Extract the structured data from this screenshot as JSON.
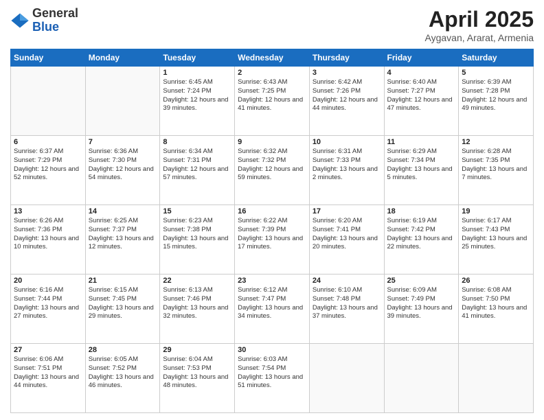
{
  "logo": {
    "general": "General",
    "blue": "Blue"
  },
  "title": "April 2025",
  "location": "Aygavan, Ararat, Armenia",
  "days_of_week": [
    "Sunday",
    "Monday",
    "Tuesday",
    "Wednesday",
    "Thursday",
    "Friday",
    "Saturday"
  ],
  "weeks": [
    [
      {
        "day": "",
        "empty": true
      },
      {
        "day": "",
        "empty": true
      },
      {
        "day": "1",
        "sunrise": "6:45 AM",
        "sunset": "7:24 PM",
        "daylight": "12 hours and 39 minutes."
      },
      {
        "day": "2",
        "sunrise": "6:43 AM",
        "sunset": "7:25 PM",
        "daylight": "12 hours and 41 minutes."
      },
      {
        "day": "3",
        "sunrise": "6:42 AM",
        "sunset": "7:26 PM",
        "daylight": "12 hours and 44 minutes."
      },
      {
        "day": "4",
        "sunrise": "6:40 AM",
        "sunset": "7:27 PM",
        "daylight": "12 hours and 47 minutes."
      },
      {
        "day": "5",
        "sunrise": "6:39 AM",
        "sunset": "7:28 PM",
        "daylight": "12 hours and 49 minutes."
      }
    ],
    [
      {
        "day": "6",
        "sunrise": "6:37 AM",
        "sunset": "7:29 PM",
        "daylight": "12 hours and 52 minutes."
      },
      {
        "day": "7",
        "sunrise": "6:36 AM",
        "sunset": "7:30 PM",
        "daylight": "12 hours and 54 minutes."
      },
      {
        "day": "8",
        "sunrise": "6:34 AM",
        "sunset": "7:31 PM",
        "daylight": "12 hours and 57 minutes."
      },
      {
        "day": "9",
        "sunrise": "6:32 AM",
        "sunset": "7:32 PM",
        "daylight": "12 hours and 59 minutes."
      },
      {
        "day": "10",
        "sunrise": "6:31 AM",
        "sunset": "7:33 PM",
        "daylight": "13 hours and 2 minutes."
      },
      {
        "day": "11",
        "sunrise": "6:29 AM",
        "sunset": "7:34 PM",
        "daylight": "13 hours and 5 minutes."
      },
      {
        "day": "12",
        "sunrise": "6:28 AM",
        "sunset": "7:35 PM",
        "daylight": "13 hours and 7 minutes."
      }
    ],
    [
      {
        "day": "13",
        "sunrise": "6:26 AM",
        "sunset": "7:36 PM",
        "daylight": "13 hours and 10 minutes."
      },
      {
        "day": "14",
        "sunrise": "6:25 AM",
        "sunset": "7:37 PM",
        "daylight": "13 hours and 12 minutes."
      },
      {
        "day": "15",
        "sunrise": "6:23 AM",
        "sunset": "7:38 PM",
        "daylight": "13 hours and 15 minutes."
      },
      {
        "day": "16",
        "sunrise": "6:22 AM",
        "sunset": "7:39 PM",
        "daylight": "13 hours and 17 minutes."
      },
      {
        "day": "17",
        "sunrise": "6:20 AM",
        "sunset": "7:41 PM",
        "daylight": "13 hours and 20 minutes."
      },
      {
        "day": "18",
        "sunrise": "6:19 AM",
        "sunset": "7:42 PM",
        "daylight": "13 hours and 22 minutes."
      },
      {
        "day": "19",
        "sunrise": "6:17 AM",
        "sunset": "7:43 PM",
        "daylight": "13 hours and 25 minutes."
      }
    ],
    [
      {
        "day": "20",
        "sunrise": "6:16 AM",
        "sunset": "7:44 PM",
        "daylight": "13 hours and 27 minutes."
      },
      {
        "day": "21",
        "sunrise": "6:15 AM",
        "sunset": "7:45 PM",
        "daylight": "13 hours and 29 minutes."
      },
      {
        "day": "22",
        "sunrise": "6:13 AM",
        "sunset": "7:46 PM",
        "daylight": "13 hours and 32 minutes."
      },
      {
        "day": "23",
        "sunrise": "6:12 AM",
        "sunset": "7:47 PM",
        "daylight": "13 hours and 34 minutes."
      },
      {
        "day": "24",
        "sunrise": "6:10 AM",
        "sunset": "7:48 PM",
        "daylight": "13 hours and 37 minutes."
      },
      {
        "day": "25",
        "sunrise": "6:09 AM",
        "sunset": "7:49 PM",
        "daylight": "13 hours and 39 minutes."
      },
      {
        "day": "26",
        "sunrise": "6:08 AM",
        "sunset": "7:50 PM",
        "daylight": "13 hours and 41 minutes."
      }
    ],
    [
      {
        "day": "27",
        "sunrise": "6:06 AM",
        "sunset": "7:51 PM",
        "daylight": "13 hours and 44 minutes."
      },
      {
        "day": "28",
        "sunrise": "6:05 AM",
        "sunset": "7:52 PM",
        "daylight": "13 hours and 46 minutes."
      },
      {
        "day": "29",
        "sunrise": "6:04 AM",
        "sunset": "7:53 PM",
        "daylight": "13 hours and 48 minutes."
      },
      {
        "day": "30",
        "sunrise": "6:03 AM",
        "sunset": "7:54 PM",
        "daylight": "13 hours and 51 minutes."
      },
      {
        "day": "",
        "empty": true
      },
      {
        "day": "",
        "empty": true
      },
      {
        "day": "",
        "empty": true
      }
    ]
  ],
  "labels": {
    "sunrise": "Sunrise:",
    "sunset": "Sunset:",
    "daylight": "Daylight:"
  }
}
